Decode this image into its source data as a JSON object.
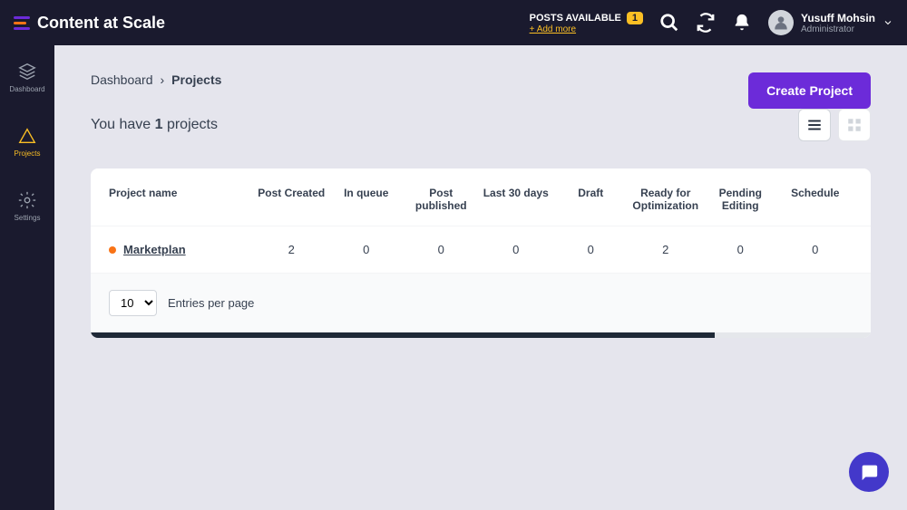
{
  "brand": "Content at Scale",
  "topbar": {
    "posts_available_label": "POSTS AVAILABLE",
    "posts_available_count": "1",
    "add_more_label": "+ Add more"
  },
  "user": {
    "name": "Yusuff Mohsin",
    "role": "Administrator"
  },
  "sidebar": {
    "items": [
      {
        "label": "Dashboard"
      },
      {
        "label": "Projects"
      },
      {
        "label": "Settings"
      }
    ]
  },
  "breadcrumb": {
    "parent": "Dashboard",
    "sep": "›",
    "current": "Projects"
  },
  "actions": {
    "create_project": "Create Project"
  },
  "subhead": {
    "prefix": "You have ",
    "count": "1",
    "suffix": " projects"
  },
  "table": {
    "headers": {
      "name": "Project name",
      "post_created": "Post Created",
      "in_queue": "In queue",
      "post_published": "Post published",
      "last30": "Last 30 days",
      "draft": "Draft",
      "ready": "Ready for Optimization",
      "pending": "Pending Editing",
      "schedule": "Schedule"
    },
    "rows": [
      {
        "name": "Marketplan",
        "post_created": "2",
        "in_queue": "0",
        "post_published": "0",
        "last30": "0",
        "draft": "0",
        "ready": "2",
        "pending": "0",
        "schedule": "0"
      }
    ]
  },
  "pagination": {
    "entries": "10",
    "label": "Entries per page"
  }
}
